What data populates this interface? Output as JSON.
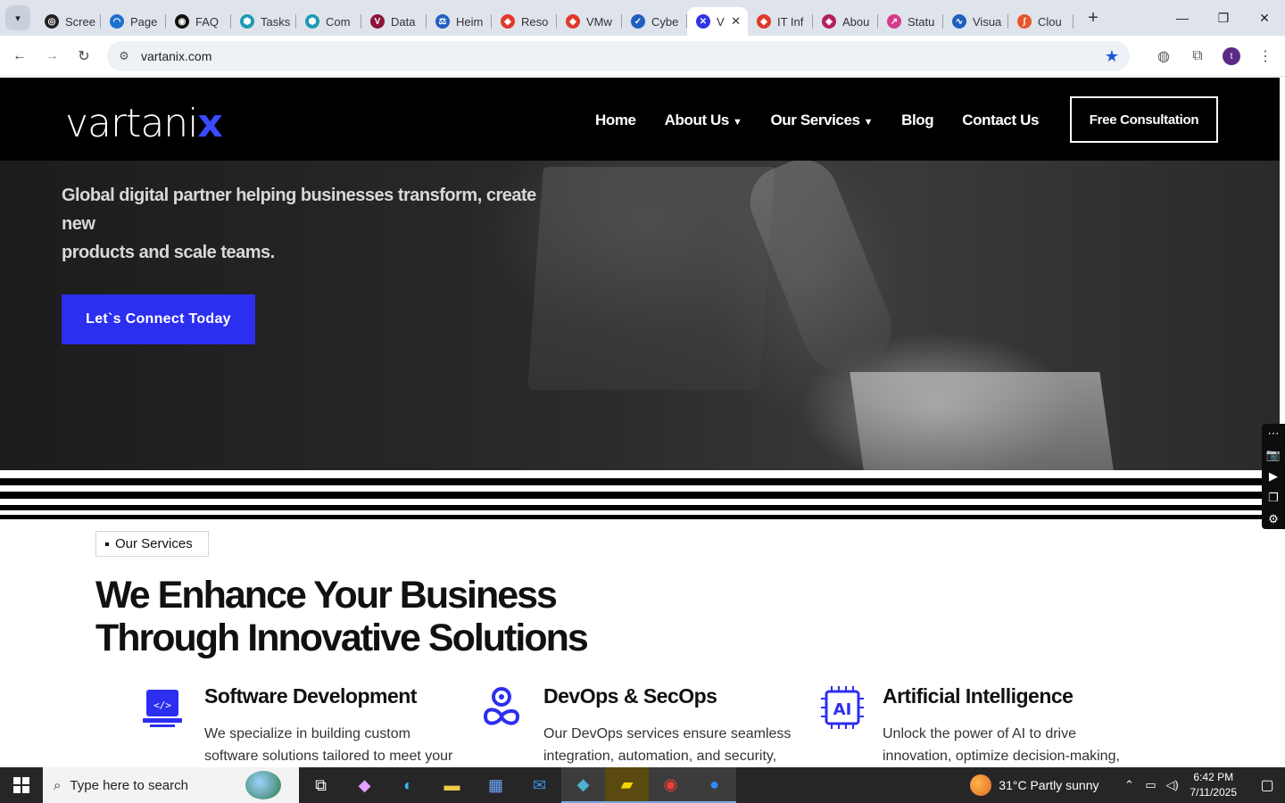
{
  "browser": {
    "tabs": [
      {
        "label": "Scree",
        "color": "#222222",
        "glyph": "◎"
      },
      {
        "label": "Page",
        "color": "#1f6fd1",
        "glyph": "◠"
      },
      {
        "label": "FAQ",
        "color": "#111111",
        "glyph": "◉"
      },
      {
        "label": "Tasks",
        "color": "#1d9bb5",
        "glyph": "⬢"
      },
      {
        "label": "Com",
        "color": "#1d9bb5",
        "glyph": "⬢"
      },
      {
        "label": "Data",
        "color": "#8a1538",
        "glyph": "V"
      },
      {
        "label": "Heim",
        "color": "#1f5fbf",
        "glyph": "⚖"
      },
      {
        "label": "Reso",
        "color": "#e0392b",
        "glyph": "◆"
      },
      {
        "label": "VMw",
        "color": "#e0392b",
        "glyph": "◆"
      },
      {
        "label": "Cybe",
        "color": "#1f5fbf",
        "glyph": "✓"
      },
      {
        "label": "V",
        "color": "#2d33e6",
        "glyph": "✕",
        "active": true
      },
      {
        "label": "IT Inf",
        "color": "#e0392b",
        "glyph": "◆"
      },
      {
        "label": "Abou",
        "color": "#b3205a",
        "glyph": "◈"
      },
      {
        "label": "Statu",
        "color": "#d63a8a",
        "glyph": "↗"
      },
      {
        "label": "Visua",
        "color": "#1f5fbf",
        "glyph": "∿"
      },
      {
        "label": "Clou",
        "color": "#e8542b",
        "glyph": "∫"
      }
    ],
    "url": "vartanix.com",
    "profile_initial": "t"
  },
  "site": {
    "logo": "vartani",
    "logo_accent": "x",
    "nav": {
      "home": "Home",
      "about": "About Us",
      "services": "Our Services",
      "blog": "Blog",
      "contact": "Contact Us"
    },
    "cta": "Free Consultation",
    "hero": {
      "line1": "Global digital partner helping businesses transform, create",
      "line2": "new",
      "line3": "products and scale teams.",
      "button": "Let`s Connect Today"
    },
    "section": {
      "eyebrow": "Our Services",
      "headline1": "We Enhance Your Business",
      "headline2": "Through Innovative Solutions"
    },
    "services": [
      {
        "title": "Software Development",
        "desc": "We specialize in building custom software solutions tailored to meet your"
      },
      {
        "title": "DevOps & SecOps",
        "desc": "Our DevOps services ensure seamless integration, automation, and security,"
      },
      {
        "title": "Artificial Intelligence",
        "desc": "Unlock the power of AI to drive innovation, optimize decision-making,"
      }
    ],
    "accent_color": "#2c2ef0"
  },
  "taskbar": {
    "search_placeholder": "Type here to search",
    "weather": "31°C  Partly sunny",
    "time": "6:42 PM",
    "date": "7/11/2025"
  }
}
